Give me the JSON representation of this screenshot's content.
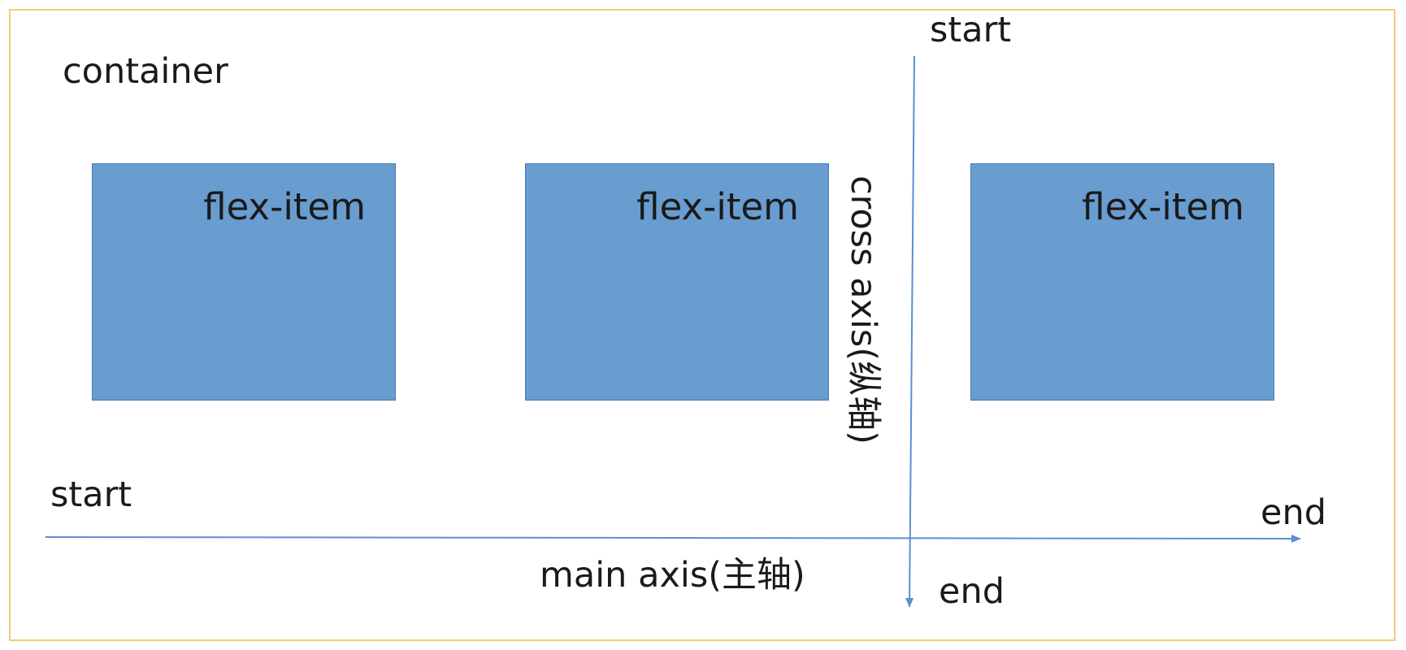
{
  "container_label": "container",
  "items": [
    {
      "label": "flex-item"
    },
    {
      "label": "flex-item"
    },
    {
      "label": "flex-item"
    }
  ],
  "main_axis": {
    "start": "start",
    "end": "end",
    "label": "main axis(主轴)"
  },
  "cross_axis": {
    "start": "start",
    "end": "end",
    "label": "cross axis(纵轴)"
  },
  "colors": {
    "container_border": "#f2cc74",
    "item_fill": "#699ccf",
    "item_border": "#4a7ab0",
    "axis": "#5b8fd1"
  }
}
